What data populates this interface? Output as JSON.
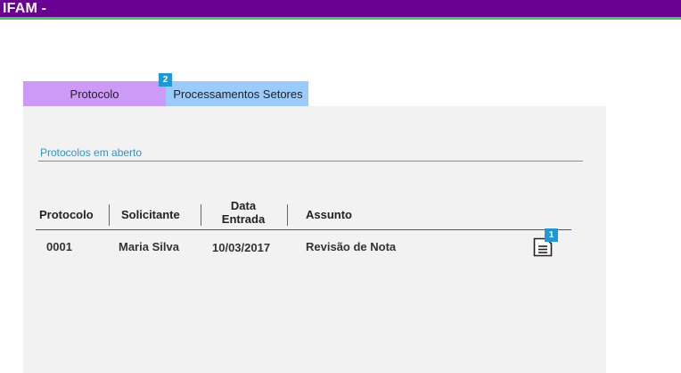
{
  "header": {
    "title": "IFAM -"
  },
  "tabs": [
    {
      "label": "Protocolo"
    },
    {
      "label": "Processamentos Setores",
      "badge": "2"
    }
  ],
  "section": {
    "title": "Protocolos em aberto"
  },
  "table": {
    "columns": [
      "Protocolo",
      "Solicitante",
      "Data\nEntrada",
      "Assunto"
    ],
    "column_data_lines": [
      "Data",
      "Entrada"
    ],
    "rows": [
      {
        "protocolo": "0001",
        "solicitante": "Maria Silva",
        "data_entrada": "10/03/2017",
        "assunto": "Revisão de Nota",
        "action_icon": "document-icon",
        "action_badge": "1"
      }
    ]
  },
  "colors": {
    "topbar": "#680094",
    "topbar_border": "#3fcd46",
    "tab_active": "#cd9bf7",
    "tab_inactive": "#9bcbfa",
    "badge": "#1e98d7",
    "section_title": "#2f93cf",
    "panel": "#f2f2f2"
  }
}
